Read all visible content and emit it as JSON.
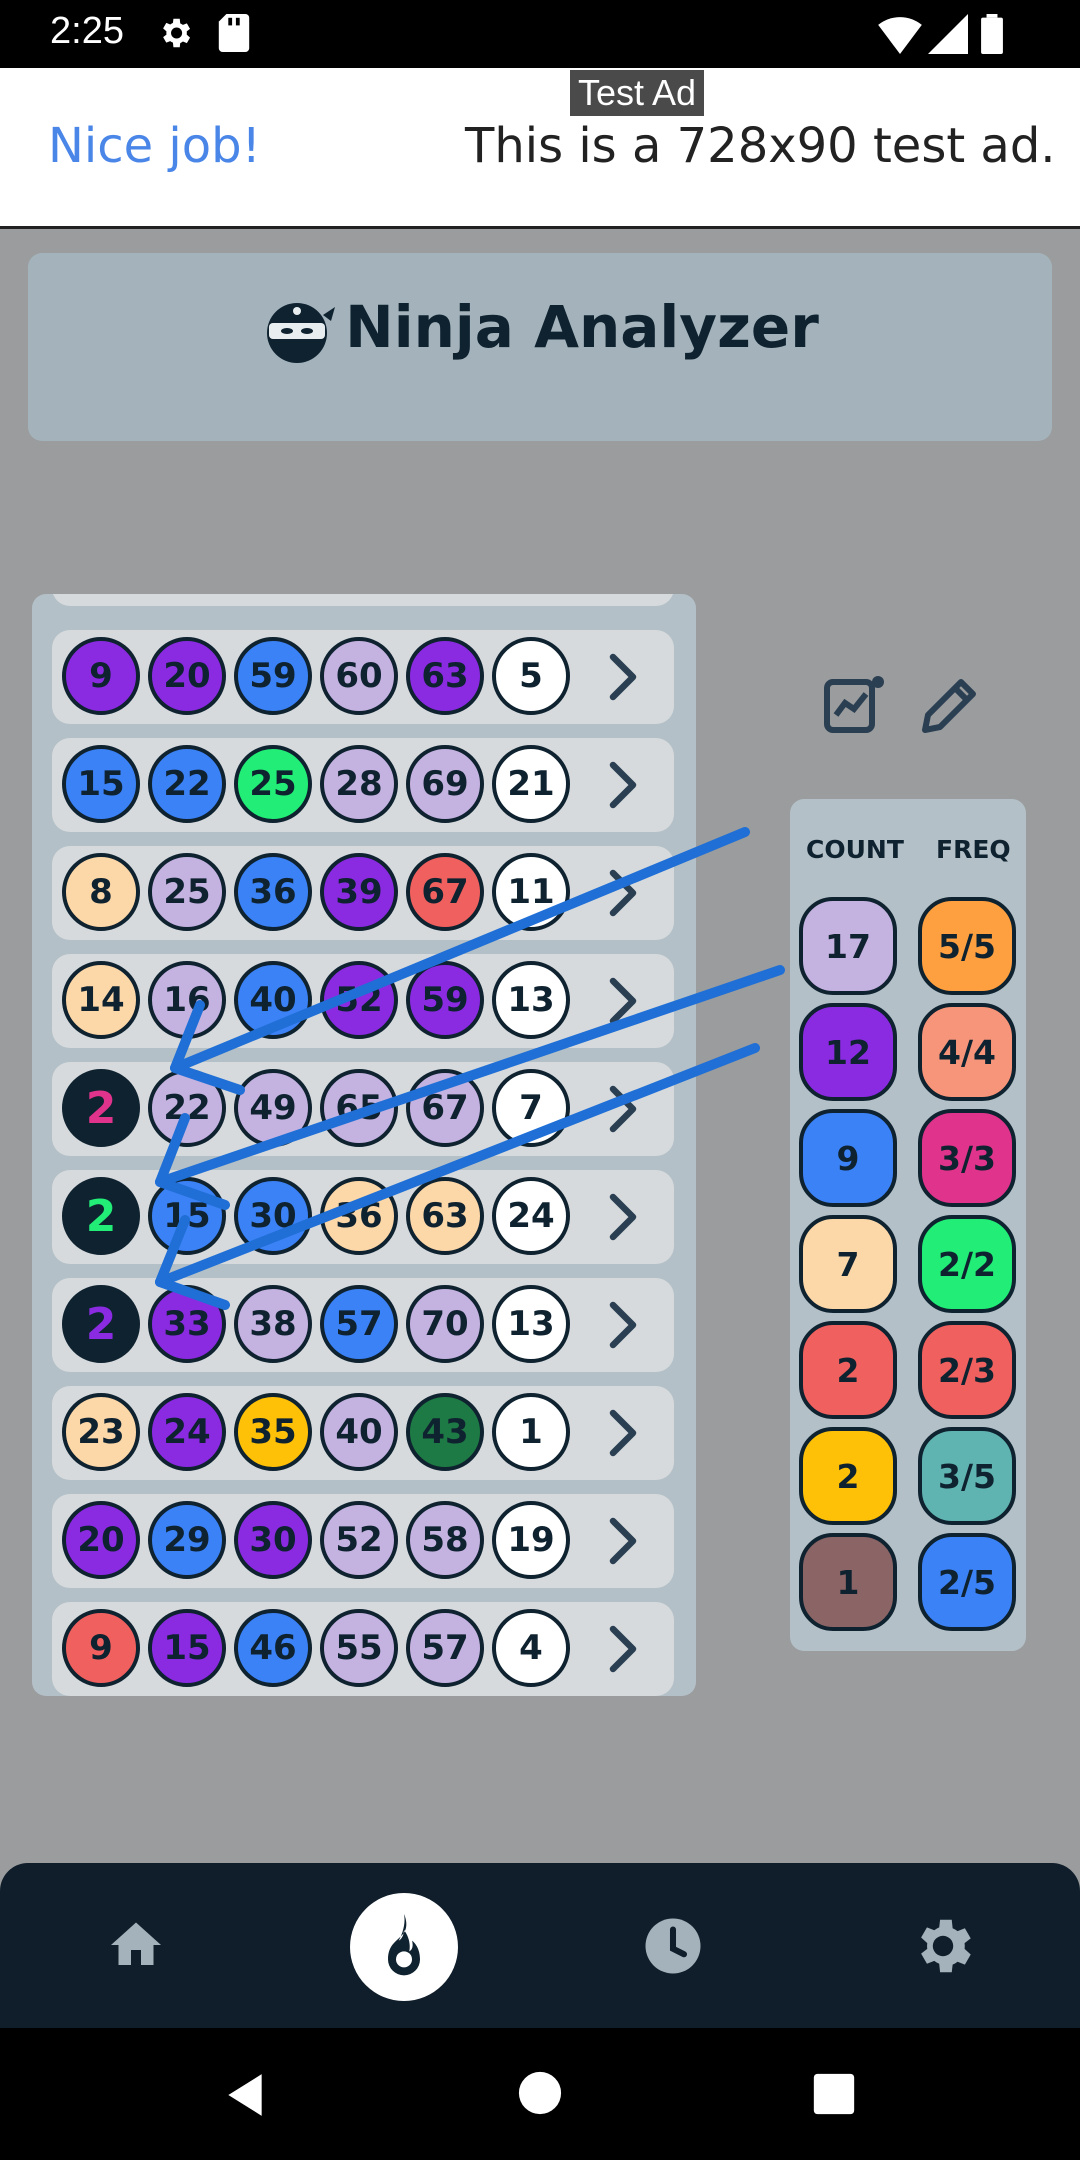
{
  "status_bar": {
    "time": "2:25"
  },
  "ad": {
    "tag": "Test Ad",
    "left_text": "Nice job!",
    "right_text": "This is a 728x90 test ad."
  },
  "header": {
    "title": "Ninja Analyzer"
  },
  "rows": [
    {
      "balls": [
        "9",
        "20",
        "59",
        "60",
        "63",
        "5"
      ],
      "colors": [
        "#8a2be2",
        "#8a2be2",
        "#3b82f6",
        "#c4b2e0",
        "#8a2be2",
        "#ffffff"
      ],
      "text_colors": [
        "#0f2230",
        "#0f2230",
        "#0f2230",
        "#0f2230",
        "#0f2230",
        "#0f2230"
      ]
    },
    {
      "balls": [
        "15",
        "22",
        "25",
        "28",
        "69",
        "21"
      ],
      "colors": [
        "#3b82f6",
        "#3b82f6",
        "#22ee77",
        "#c4b2e0",
        "#c4b2e0",
        "#ffffff"
      ],
      "text_colors": [
        "#0f2230",
        "#0f2230",
        "#0f2230",
        "#0f2230",
        "#0f2230",
        "#0f2230"
      ]
    },
    {
      "balls": [
        "8",
        "25",
        "36",
        "39",
        "67",
        "11"
      ],
      "colors": [
        "#fcd7a8",
        "#c4b2e0",
        "#3b82f6",
        "#8a2be2",
        "#f0605e",
        "#ffffff"
      ],
      "text_colors": [
        "#0f2230",
        "#0f2230",
        "#0f2230",
        "#0f2230",
        "#0f2230",
        "#0f2230"
      ]
    },
    {
      "balls": [
        "14",
        "16",
        "40",
        "52",
        "59",
        "13"
      ],
      "colors": [
        "#fcd7a8",
        "#c4b2e0",
        "#3b82f6",
        "#8a2be2",
        "#8a2be2",
        "#ffffff"
      ],
      "text_colors": [
        "#0f2230",
        "#0f2230",
        "#0f2230",
        "#0f2230",
        "#0f2230",
        "#0f2230"
      ]
    },
    {
      "balls": [
        "2",
        "22",
        "49",
        "65",
        "67",
        "7"
      ],
      "colors": [
        "#0f2230",
        "#c4b2e0",
        "#c4b2e0",
        "#c4b2e0",
        "#c4b2e0",
        "#ffffff"
      ],
      "text_colors": [
        "#e0338c",
        "#0f2230",
        "#0f2230",
        "#0f2230",
        "#0f2230",
        "#0f2230"
      ]
    },
    {
      "balls": [
        "2",
        "15",
        "30",
        "36",
        "63",
        "24"
      ],
      "colors": [
        "#0f2230",
        "#3b82f6",
        "#3b82f6",
        "#fcd7a8",
        "#fcd7a8",
        "#ffffff"
      ],
      "text_colors": [
        "#22ee77",
        "#0f2230",
        "#0f2230",
        "#0f2230",
        "#0f2230",
        "#0f2230"
      ]
    },
    {
      "balls": [
        "2",
        "33",
        "38",
        "57",
        "70",
        "13"
      ],
      "colors": [
        "#0f2230",
        "#8a2be2",
        "#c4b2e0",
        "#3b82f6",
        "#c4b2e0",
        "#ffffff"
      ],
      "text_colors": [
        "#8a2be2",
        "#0f2230",
        "#0f2230",
        "#0f2230",
        "#0f2230",
        "#0f2230"
      ]
    },
    {
      "balls": [
        "23",
        "24",
        "35",
        "40",
        "43",
        "1"
      ],
      "colors": [
        "#fcd7a8",
        "#8a2be2",
        "#ffc107",
        "#c4b2e0",
        "#1e7a44",
        "#ffffff"
      ],
      "text_colors": [
        "#0f2230",
        "#0f2230",
        "#0f2230",
        "#0f2230",
        "#0f2230",
        "#0f2230"
      ]
    },
    {
      "balls": [
        "20",
        "29",
        "30",
        "52",
        "58",
        "19"
      ],
      "colors": [
        "#8a2be2",
        "#3b82f6",
        "#8a2be2",
        "#c4b2e0",
        "#c4b2e0",
        "#ffffff"
      ],
      "text_colors": [
        "#0f2230",
        "#0f2230",
        "#0f2230",
        "#0f2230",
        "#0f2230",
        "#0f2230"
      ]
    },
    {
      "balls": [
        "9",
        "15",
        "46",
        "55",
        "57",
        "4"
      ],
      "colors": [
        "#f0605e",
        "#8a2be2",
        "#3b82f6",
        "#c4b2e0",
        "#c4b2e0",
        "#ffffff"
      ],
      "text_colors": [
        "#0f2230",
        "#0f2230",
        "#0f2230",
        "#0f2230",
        "#0f2230",
        "#0f2230"
      ]
    }
  ],
  "stats": {
    "count_header": "COUNT",
    "freq_header": "FREQ",
    "count": [
      {
        "value": "17",
        "color": "#c4b2e0"
      },
      {
        "value": "12",
        "color": "#8a2be2"
      },
      {
        "value": "9",
        "color": "#3b82f6"
      },
      {
        "value": "7",
        "color": "#fcd7a8"
      },
      {
        "value": "2",
        "color": "#f0605e"
      },
      {
        "value": "2",
        "color": "#ffc107"
      },
      {
        "value": "1",
        "color": "#8b6565"
      }
    ],
    "freq": [
      {
        "value": "5/5",
        "color": "#ffa040"
      },
      {
        "value": "4/4",
        "color": "#f7957a"
      },
      {
        "value": "3/3",
        "color": "#e0338c"
      },
      {
        "value": "2/2",
        "color": "#22ee77"
      },
      {
        "value": "2/3",
        "color": "#f0605e"
      },
      {
        "value": "3/5",
        "color": "#5fb3b0"
      },
      {
        "value": "2/5",
        "color": "#3b82f6"
      }
    ]
  },
  "bottom_nav": [
    "home-icon",
    "fire-icon",
    "history-icon",
    "settings-icon"
  ]
}
